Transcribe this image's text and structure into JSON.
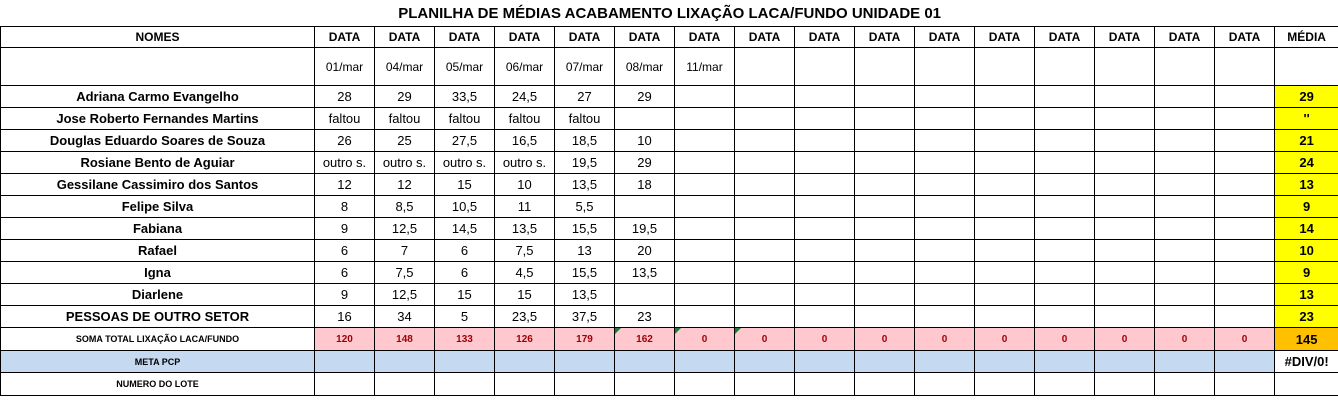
{
  "title": "PLANILHA DE MÉDIAS ACABAMENTO LIXAÇÃO LACA/FUNDO UNIDADE 01",
  "headers": {
    "nomes": "NOMES",
    "data": [
      "DATA",
      "DATA",
      "DATA",
      "DATA",
      "DATA",
      "DATA",
      "DATA",
      "DATA",
      "DATA",
      "DATA",
      "DATA",
      "DATA",
      "DATA",
      "DATA",
      "DATA",
      "DATA"
    ],
    "media": "MÉDIA"
  },
  "dates": [
    "01/mar",
    "04/mar",
    "05/mar",
    "06/mar",
    "07/mar",
    "08/mar",
    "11/mar",
    "",
    "",
    "",
    "",
    "",
    "",
    "",
    "",
    ""
  ],
  "employees": [
    {
      "name": "Adriana Carmo Evangelho",
      "values": [
        "28",
        "29",
        "33,5",
        "24,5",
        "27",
        "29",
        "",
        "",
        "",
        "",
        "",
        "",
        "",
        "",
        "",
        ""
      ],
      "media": "29"
    },
    {
      "name": "Jose Roberto Fernandes Martins",
      "values": [
        "faltou",
        "faltou",
        "faltou",
        "faltou",
        "faltou",
        "",
        "",
        "",
        "",
        "",
        "",
        "",
        "",
        "",
        "",
        ""
      ],
      "media": "''"
    },
    {
      "name": "Douglas Eduardo Soares de Souza",
      "values": [
        "26",
        "25",
        "27,5",
        "16,5",
        "18,5",
        "10",
        "",
        "",
        "",
        "",
        "",
        "",
        "",
        "",
        "",
        ""
      ],
      "media": "21"
    },
    {
      "name": "Rosiane Bento de Aguiar",
      "values": [
        "outro s.",
        "outro s.",
        "outro s.",
        "outro s.",
        "19,5",
        "29",
        "",
        "",
        "",
        "",
        "",
        "",
        "",
        "",
        "",
        ""
      ],
      "media": "24"
    },
    {
      "name": "Gessilane Cassimiro dos Santos",
      "values": [
        "12",
        "12",
        "15",
        "10",
        "13,5",
        "18",
        "",
        "",
        "",
        "",
        "",
        "",
        "",
        "",
        "",
        ""
      ],
      "media": "13"
    },
    {
      "name": "Felipe Silva",
      "values": [
        "8",
        "8,5",
        "10,5",
        "11",
        "5,5",
        "",
        "",
        "",
        "",
        "",
        "",
        "",
        "",
        "",
        "",
        ""
      ],
      "media": "9"
    },
    {
      "name": "Fabiana",
      "values": [
        "9",
        "12,5",
        "14,5",
        "13,5",
        "15,5",
        "19,5",
        "",
        "",
        "",
        "",
        "",
        "",
        "",
        "",
        "",
        ""
      ],
      "media": "14"
    },
    {
      "name": "Rafael",
      "values": [
        "6",
        "7",
        "6",
        "7,5",
        "13",
        "20",
        "",
        "",
        "",
        "",
        "",
        "",
        "",
        "",
        "",
        ""
      ],
      "media": "10"
    },
    {
      "name": "Igna",
      "values": [
        "6",
        "7,5",
        "6",
        "4,5",
        "15,5",
        "13,5",
        "",
        "",
        "",
        "",
        "",
        "",
        "",
        "",
        "",
        ""
      ],
      "media": "9"
    },
    {
      "name": "Diarlene",
      "values": [
        "9",
        "12,5",
        "15",
        "15",
        "13,5",
        "",
        "",
        "",
        "",
        "",
        "",
        "",
        "",
        "",
        "",
        ""
      ],
      "media": "13"
    },
    {
      "name": "PESSOAS DE OUTRO SETOR",
      "values": [
        "16",
        "34",
        "5",
        "23,5",
        "37,5",
        "23",
        "",
        "",
        "",
        "",
        "",
        "",
        "",
        "",
        "",
        ""
      ],
      "media": "23"
    }
  ],
  "soma": {
    "label": "SOMA TOTAL LIXAÇÃO LACA/FUNDO",
    "values": [
      "120",
      "148",
      "133",
      "126",
      "179",
      "162",
      "0",
      "0",
      "0",
      "0",
      "0",
      "0",
      "0",
      "0",
      "0",
      "0"
    ],
    "total": "145"
  },
  "meta": {
    "label": "META PCP",
    "value": "#DIV/0!"
  },
  "lote": {
    "label": "NUMERO DO LOTE"
  },
  "colors": {
    "media_fill": "#ffff00",
    "sum_fill": "#ffc7ce",
    "sum_text": "#9c0006",
    "total_fill": "#ffc000",
    "meta_fill": "#c5d9f1",
    "marker": "#1e7a3a"
  }
}
